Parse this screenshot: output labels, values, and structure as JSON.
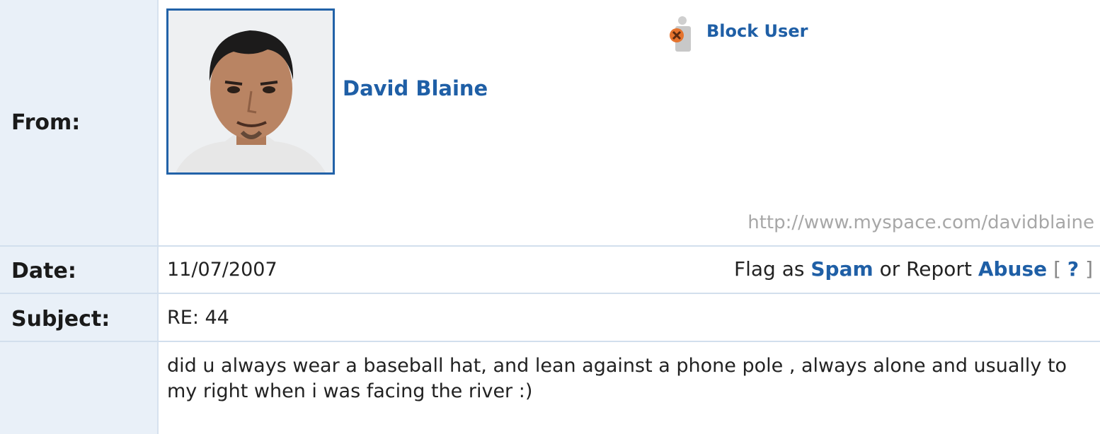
{
  "labels": {
    "from": "From:",
    "date": "Date:",
    "subject": "Subject:"
  },
  "sender": {
    "name": "David Blaine",
    "profile_url": "http://www.myspace.com/davidblaine",
    "block_label": "Block User",
    "avatar_icon": "user-photo"
  },
  "message": {
    "date": "11/07/2007",
    "subject": "RE: 44",
    "body": "did u always wear a baseball hat, and lean against a phone pole , always alone and usually to my right when i was facing the river :)"
  },
  "flag": {
    "prefix": "Flag as",
    "spam": "Spam",
    "middle": "or Report",
    "abuse": "Abuse",
    "open_bracket": "[",
    "help": "?",
    "close_bracket": "]"
  },
  "colors": {
    "link": "#1f5fa6",
    "label_bg": "#e9f0f8",
    "muted_text": "#a7a7a7"
  }
}
